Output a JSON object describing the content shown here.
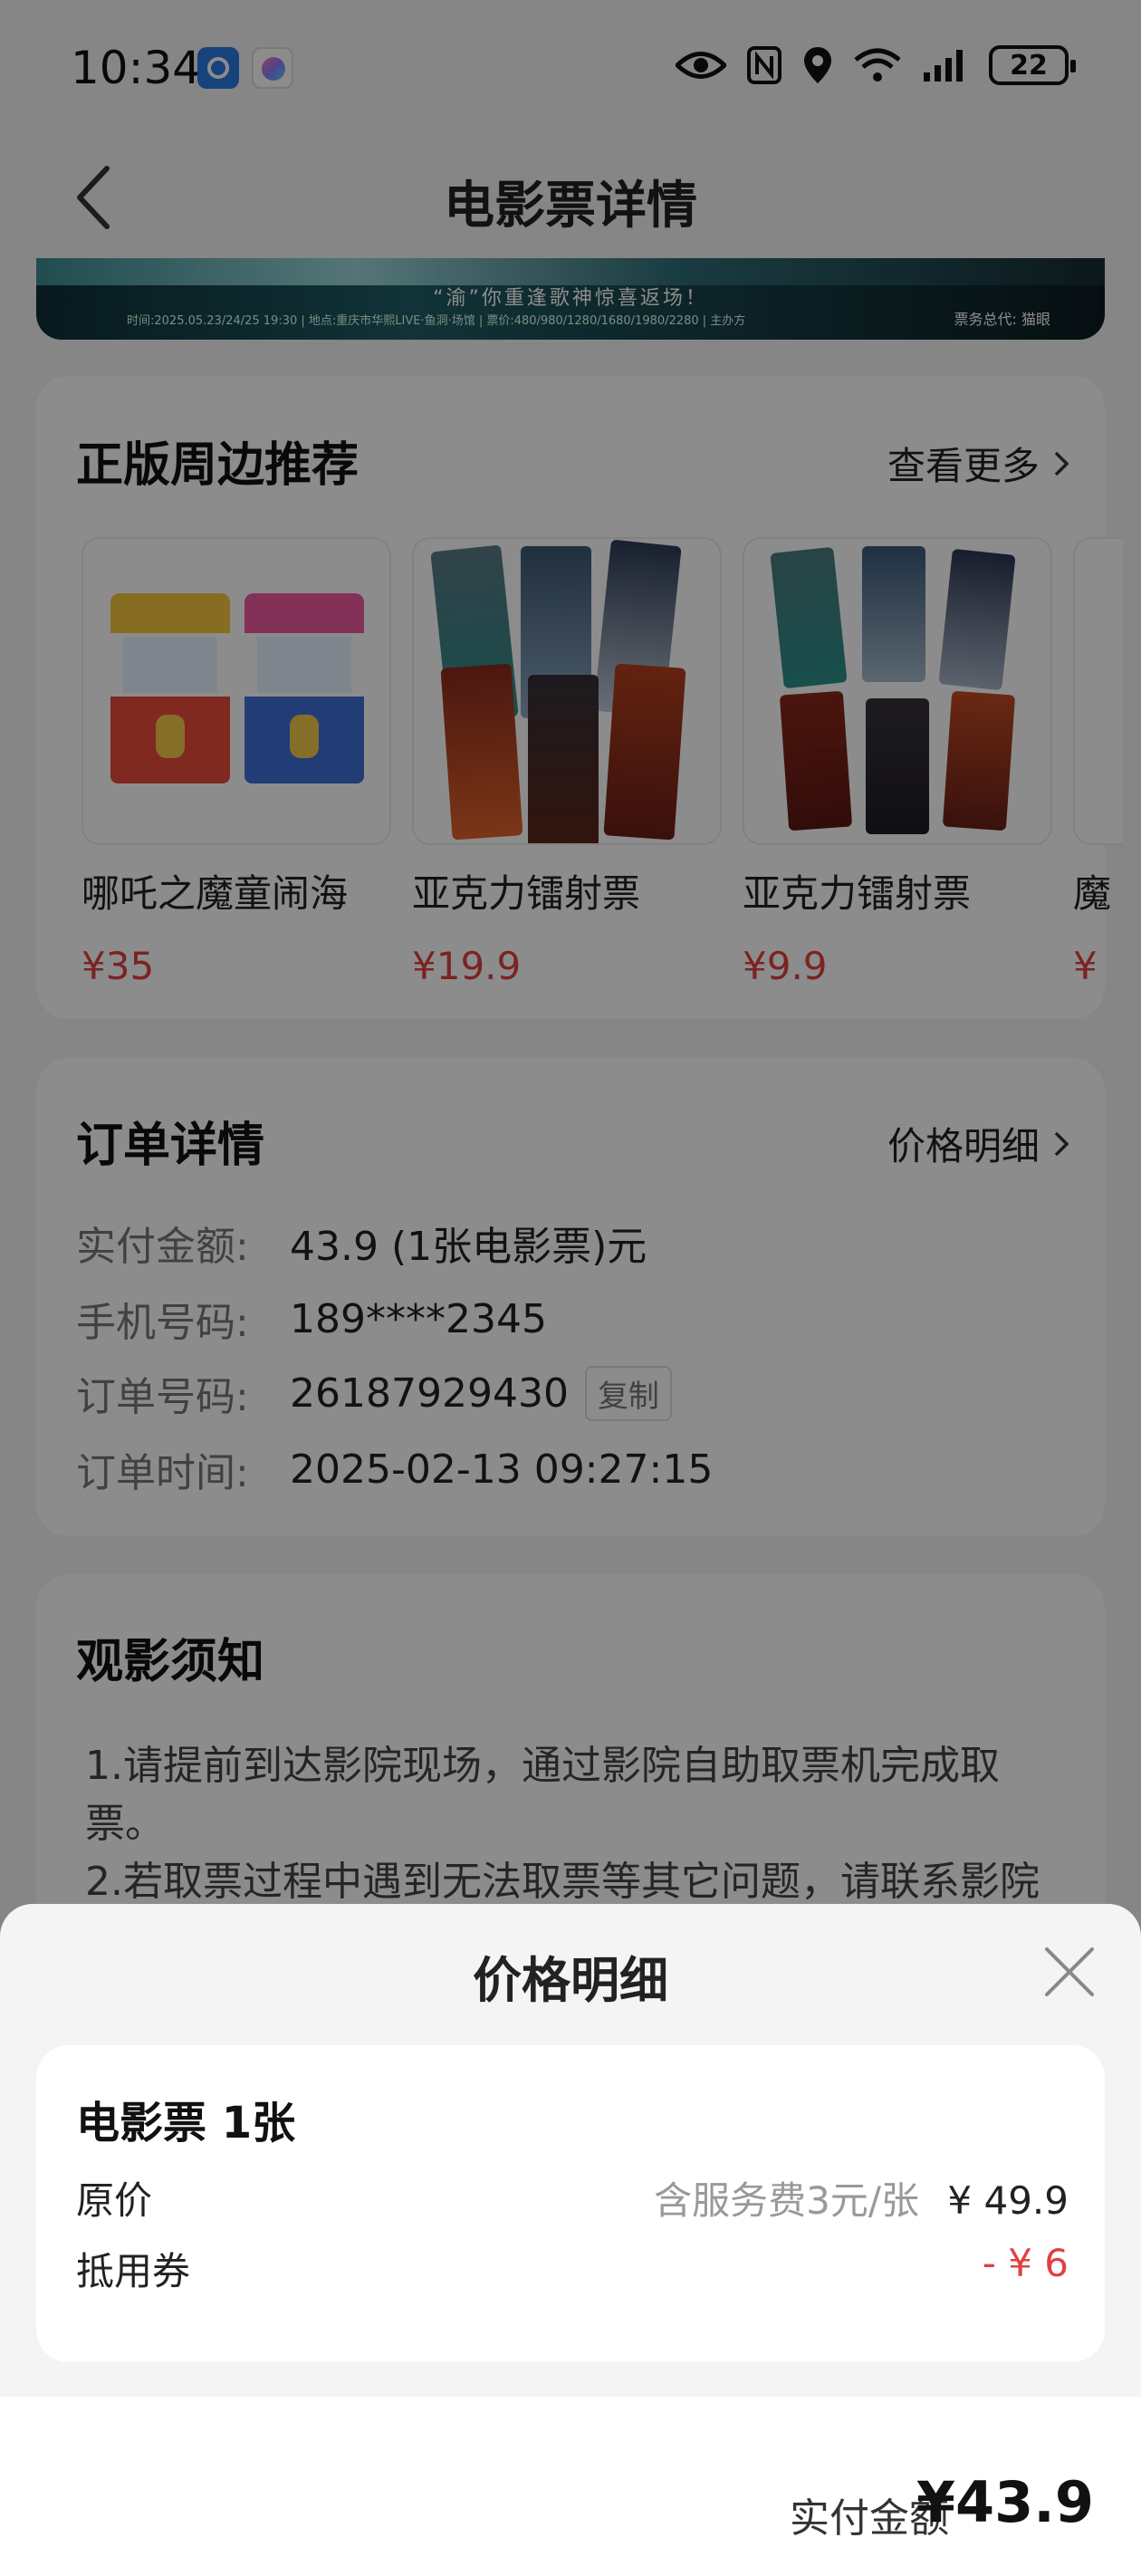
{
  "status_bar": {
    "time": "10:34",
    "battery": "22"
  },
  "header": {
    "title": "电影票详情"
  },
  "banner": {
    "slogan": "“渝”你重逢歌神惊喜返场！",
    "info": "时间:2025.05.23/24/25  19:30  | 地点:重庆市华熙LIVE·鱼洞·场馆 | 票价:480/980/1280/1680/1980/2280 | 主办方",
    "agent": "票务总代: 猫眼"
  },
  "merch": {
    "title": "正版周边推荐",
    "more": "查看更多",
    "items": [
      {
        "name": "哪吒之魔童闹海",
        "price": "¥35"
      },
      {
        "name": "亚克力镭射票",
        "price": "¥19.9"
      },
      {
        "name": "亚克力镭射票",
        "price": "¥9.9"
      },
      {
        "name": "魔",
        "price": "¥"
      }
    ]
  },
  "order": {
    "title": "订单详情",
    "price_link": "价格明细",
    "rows": [
      {
        "label": "实付金额:",
        "value": "43.9 (1张电影票)元"
      },
      {
        "label": "手机号码:",
        "value": "189****2345"
      },
      {
        "label": "订单号码:",
        "value": "26187929430"
      },
      {
        "label": "订单时间:",
        "value": "2025-02-13 09:27:15"
      }
    ],
    "copy": "复制"
  },
  "notice": {
    "title": "观影须知",
    "line1": "1.请提前到达影院现场，通过影院自助取票机完成取票。",
    "line2": "2.若取票过程中遇到无法取票等其它问题，请联系影院"
  },
  "sheet": {
    "title": "价格明细",
    "item_title": "电影票 1张",
    "original_label": "原价",
    "service_note": "含服务费3元/张",
    "original_price": "¥ 49.9",
    "coupon_label": "抵用券",
    "coupon_value": "- ¥ 6",
    "pay_label": "实付金额",
    "pay_amount": "¥43.9"
  },
  "colors": {
    "accent_red": "#e04040",
    "overlay": "rgba(0,0,0,0.45)"
  }
}
